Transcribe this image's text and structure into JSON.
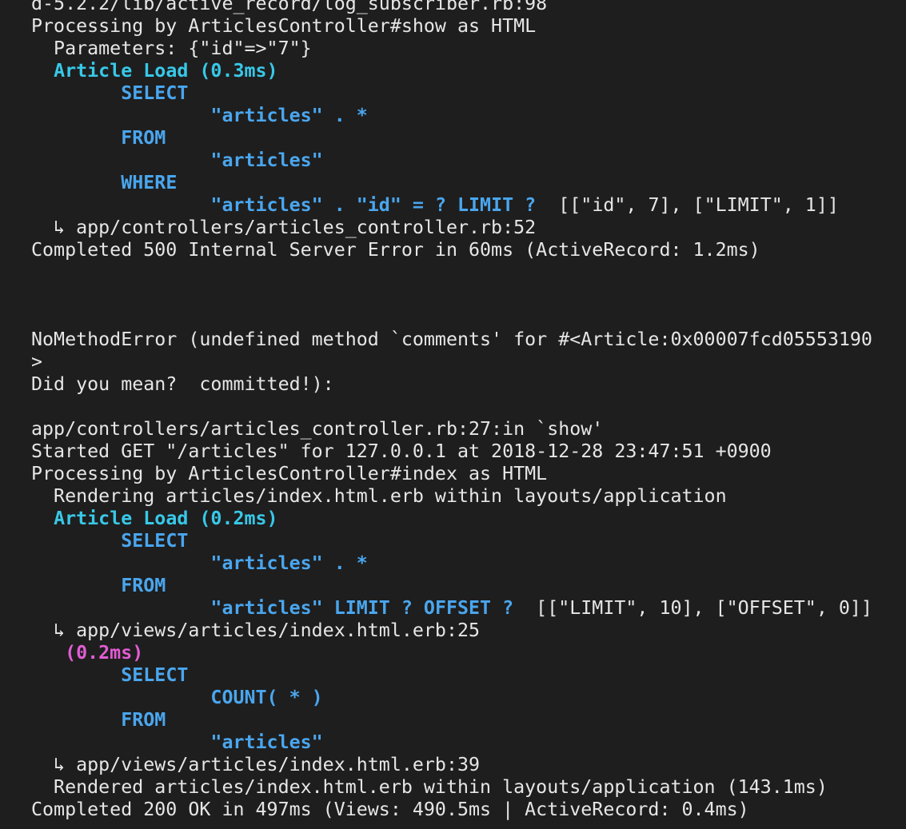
{
  "colors": {
    "background": "#1e1e1e",
    "text": "#e6e6e6",
    "model_load": "#38c8e8",
    "sql_keyword": "#4aa6ee",
    "sql_timing": "#e25cd4"
  },
  "terminal": {
    "lines": [
      [
        {
          "text": "d-5.2.2/lib/active_record/log_subscriber.rb:98",
          "style": "default"
        }
      ],
      [
        {
          "text": "Processing by ArticlesController#show as HTML",
          "style": "default"
        }
      ],
      [
        {
          "text": "  Parameters: {\"id\"=>\"7\"}",
          "style": "default"
        }
      ],
      [
        {
          "text": "  ",
          "style": "default"
        },
        {
          "text": "Article Load (0.3ms)",
          "style": "cyan"
        }
      ],
      [
        {
          "text": "        ",
          "style": "default"
        },
        {
          "text": "SELECT",
          "style": "blue"
        }
      ],
      [
        {
          "text": "                ",
          "style": "default"
        },
        {
          "text": "\"articles\" . *",
          "style": "blue"
        }
      ],
      [
        {
          "text": "        ",
          "style": "default"
        },
        {
          "text": "FROM",
          "style": "blue"
        }
      ],
      [
        {
          "text": "                ",
          "style": "default"
        },
        {
          "text": "\"articles\"",
          "style": "blue"
        }
      ],
      [
        {
          "text": "        ",
          "style": "default"
        },
        {
          "text": "WHERE",
          "style": "blue"
        }
      ],
      [
        {
          "text": "                ",
          "style": "default"
        },
        {
          "text": "\"articles\" . \"id\" = ? LIMIT ?",
          "style": "blue"
        },
        {
          "text": "  [[\"id\", 7], [\"LIMIT\", 1]]",
          "style": "default"
        }
      ],
      [
        {
          "text": "  ↳ app/controllers/articles_controller.rb:52",
          "style": "default"
        }
      ],
      [
        {
          "text": "Completed 500 Internal Server Error in 60ms (ActiveRecord: 1.2ms)",
          "style": "default"
        }
      ],
      [],
      [],
      [],
      [
        {
          "text": "NoMethodError (undefined method `comments' for #<Article:0x00007fcd05553190",
          "style": "default"
        }
      ],
      [
        {
          "text": ">",
          "style": "default"
        }
      ],
      [
        {
          "text": "Did you mean?  committed!):",
          "style": "default"
        }
      ],
      [],
      [
        {
          "text": "app/controllers/articles_controller.rb:27:in `show'",
          "style": "default"
        }
      ],
      [
        {
          "text": "Started GET \"/articles\" for 127.0.0.1 at 2018-12-28 23:47:51 +0900",
          "style": "default"
        }
      ],
      [
        {
          "text": "Processing by ArticlesController#index as HTML",
          "style": "default"
        }
      ],
      [
        {
          "text": "  Rendering articles/index.html.erb within layouts/application",
          "style": "default"
        }
      ],
      [
        {
          "text": "  ",
          "style": "default"
        },
        {
          "text": "Article Load (0.2ms)",
          "style": "cyan"
        }
      ],
      [
        {
          "text": "        ",
          "style": "default"
        },
        {
          "text": "SELECT",
          "style": "blue"
        }
      ],
      [
        {
          "text": "                ",
          "style": "default"
        },
        {
          "text": "\"articles\" . *",
          "style": "blue"
        }
      ],
      [
        {
          "text": "        ",
          "style": "default"
        },
        {
          "text": "FROM",
          "style": "blue"
        }
      ],
      [
        {
          "text": "                ",
          "style": "default"
        },
        {
          "text": "\"articles\" LIMIT ? OFFSET ?",
          "style": "blue"
        },
        {
          "text": "  [[\"LIMIT\", 10], [\"OFFSET\", 0]]",
          "style": "default"
        }
      ],
      [
        {
          "text": "  ↳ app/views/articles/index.html.erb:25",
          "style": "default"
        }
      ],
      [
        {
          "text": "   ",
          "style": "default"
        },
        {
          "text": "(0.2ms)",
          "style": "magenta"
        }
      ],
      [
        {
          "text": "        ",
          "style": "default"
        },
        {
          "text": "SELECT",
          "style": "blue"
        }
      ],
      [
        {
          "text": "                ",
          "style": "default"
        },
        {
          "text": "COUNT( * )",
          "style": "blue"
        }
      ],
      [
        {
          "text": "        ",
          "style": "default"
        },
        {
          "text": "FROM",
          "style": "blue"
        }
      ],
      [
        {
          "text": "                ",
          "style": "default"
        },
        {
          "text": "\"articles\"",
          "style": "blue"
        }
      ],
      [
        {
          "text": "  ↳ app/views/articles/index.html.erb:39",
          "style": "default"
        }
      ],
      [
        {
          "text": "  Rendered articles/index.html.erb within layouts/application (143.1ms)",
          "style": "default"
        }
      ],
      [
        {
          "text": "Completed 200 OK in 497ms (Views: 490.5ms | ActiveRecord: 0.4ms)",
          "style": "default"
        }
      ]
    ]
  }
}
